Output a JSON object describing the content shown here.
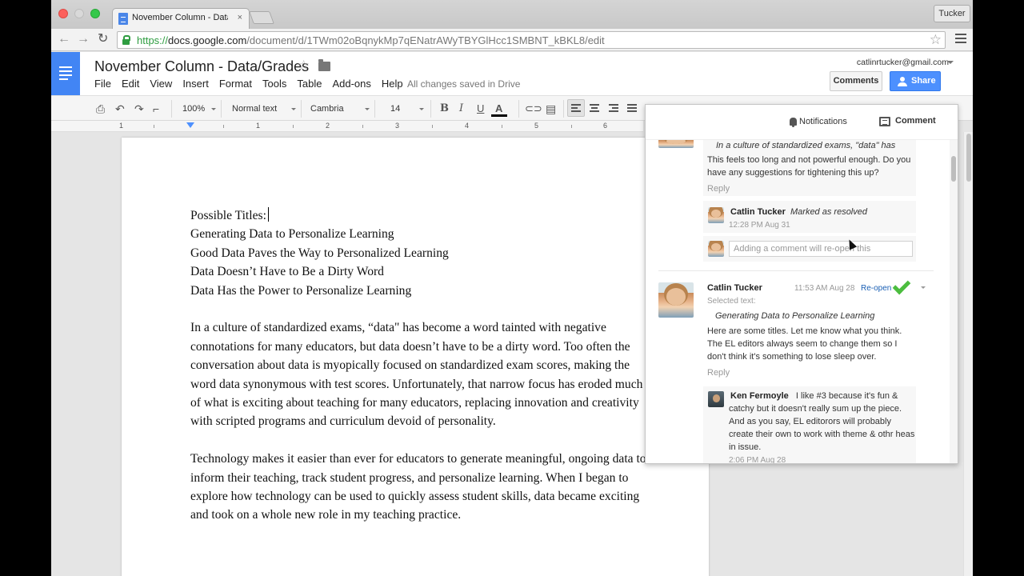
{
  "browser": {
    "tab_title": "November Column - Data/G",
    "tab_close": "×",
    "profile_name": "Tucker",
    "url_scheme": "https://",
    "url_host": "docs.google.com",
    "url_path": "/document/d/1TWm02oBqnykMp7qENatrAWyTBYGlHcc1SMBNT_kBKL8/edit",
    "back_glyph": "←",
    "forward_glyph": "→",
    "reload_glyph": "↻",
    "star_glyph": "☆"
  },
  "docs": {
    "title": "November Column - Data/Grades",
    "title_star": "☆",
    "menu": [
      "File",
      "Edit",
      "View",
      "Insert",
      "Format",
      "Tools",
      "Table",
      "Add-ons",
      "Help"
    ],
    "save_status": "All changes saved in Drive",
    "account_email": "catlinrtucker@gmail.com",
    "comments_button": "Comments",
    "share_button": "Share"
  },
  "toolbar": {
    "zoom": "100%",
    "style": "Normal text",
    "font": "Cambria",
    "size": "14",
    "bold": "B",
    "italic": "I",
    "underline": "U",
    "text_color": "A"
  },
  "ruler": {
    "numbers": [
      "1",
      "1",
      "2",
      "3",
      "4",
      "5",
      "6"
    ]
  },
  "document": {
    "titles_heading": "Possible Titles:",
    "titles": [
      "Generating Data to Personalize Learning",
      "Good Data Paves the Way to Personalized Learning",
      "Data Doesn’t Have to Be a Dirty Word",
      "Data Has the Power to Personalize Learning"
    ],
    "paragraph1": "In a culture of standardized exams, “data\" has become a word tainted with negative connotations for many educators, but data doesn’t have to be a dirty word. Too often the conversation about data is myopically focused on standardized exam scores, making the word data synonymous with test scores. Unfortunately, that narrow focus has eroded much of what is exciting about teaching for many educators, replacing innovation and creativity with scripted programs and curriculum devoid of personality.",
    "paragraph2": "Technology makes it easier than ever for educators to generate meaningful, ongoing data to inform their teaching, track student progress, and personalize learning. When I began to explore how technology can be used to quickly assess student skills, data became exciting and took on a whole new role in my teaching practice."
  },
  "comments_panel": {
    "notifications_label": "Notifications",
    "comment_label": "Comment",
    "thread1": {
      "quote": "In a culture of standardized exams, \"data\" has",
      "body_lines": [
        "This feels too long and not powerful enough. Do you",
        "have any suggestions for tightening this up?"
      ],
      "reply": "Reply",
      "resolve_author": "Catlin Tucker",
      "resolve_action": "Marked as resolved",
      "resolve_time": "12:28 PM Aug 31",
      "reopen_placeholder": "Adding a comment will re-open this"
    },
    "thread2": {
      "author": "Catlin Tucker",
      "time": "11:53 AM Aug 28",
      "reopen": "Re-open",
      "selected_label": "Selected text:",
      "quote": "Generating Data to Personalize Learning",
      "body_lines": [
        "Here are some titles. Let me know what you think.",
        "The EL editors always seem to change them so I",
        "don't think it's something to lose sleep over."
      ],
      "reply": "Reply",
      "reply_author": "Ken Fermoyle",
      "reply_lines": [
        "I like #3 because it's fun &",
        "catchy but it doesn't really sum up the piece.",
        "And as you say, EL editorors will probably",
        "create their own to work with theme & othr heas",
        "in issue."
      ],
      "reply_time": "2:06 PM Aug 28"
    }
  },
  "colors": {
    "docs_blue": "#4285f4",
    "share_blue": "#4d90fe",
    "check_green": "#4cbd3f"
  }
}
